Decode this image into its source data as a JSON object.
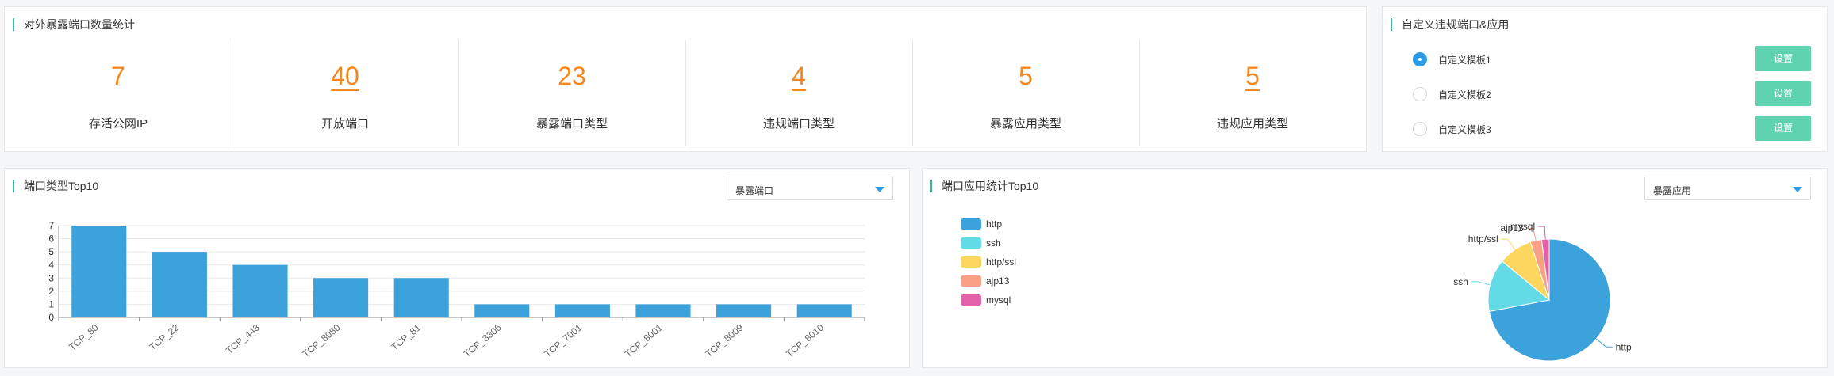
{
  "stats_panel": {
    "title": "对外暴露端口数量统计",
    "items": [
      {
        "value": "7",
        "label": "存活公网IP",
        "link": false
      },
      {
        "value": "40",
        "label": "开放端口",
        "link": true
      },
      {
        "value": "23",
        "label": "暴露端口类型",
        "link": false
      },
      {
        "value": "4",
        "label": "违规端口类型",
        "link": true
      },
      {
        "value": "5",
        "label": "暴露应用类型",
        "link": false
      },
      {
        "value": "5",
        "label": "违规应用类型",
        "link": true
      }
    ]
  },
  "template_panel": {
    "title": "自定义违规端口&应用",
    "items": [
      {
        "label": "自定义模板1",
        "checked": true,
        "button": "设置"
      },
      {
        "label": "自定义模板2",
        "checked": false,
        "button": "设置"
      },
      {
        "label": "自定义模板3",
        "checked": false,
        "button": "设置"
      }
    ]
  },
  "bar_panel": {
    "title": "端口类型Top10",
    "select_value": "暴露端口"
  },
  "pie_panel": {
    "title": "端口应用统计Top10",
    "select_value": "暴露应用"
  },
  "colors": {
    "accent": "#35b8a0",
    "orange": "#f5871f",
    "bar": "#3aa1db",
    "button": "#5fd3b0",
    "radio": "#2d9ce6"
  },
  "chart_data": [
    {
      "type": "bar",
      "title": "",
      "categories": [
        "TCP_80",
        "TCP_22",
        "TCP_443",
        "TCP_8080",
        "TCP_81",
        "TCP_3306",
        "TCP_7001",
        "TCP_8001",
        "TCP_8009",
        "TCP_8010"
      ],
      "values": [
        7,
        5,
        4,
        3,
        3,
        1,
        1,
        1,
        1,
        1
      ],
      "ylim": [
        0,
        7
      ],
      "yticks": [
        0,
        1,
        2,
        3,
        4,
        5,
        6,
        7
      ],
      "grid": true
    },
    {
      "type": "pie",
      "title": "",
      "legend_placement": "left",
      "slices": [
        {
          "label": "http",
          "value": 72,
          "color": "#3ba2db"
        },
        {
          "label": "ssh",
          "value": 14,
          "color": "#63dbe6"
        },
        {
          "label": "http/ssl",
          "value": 9,
          "color": "#fdd65f"
        },
        {
          "label": "ajp13",
          "value": 3,
          "color": "#f8a185"
        },
        {
          "label": "mysql",
          "value": 2,
          "color": "#e162a8"
        }
      ]
    }
  ]
}
